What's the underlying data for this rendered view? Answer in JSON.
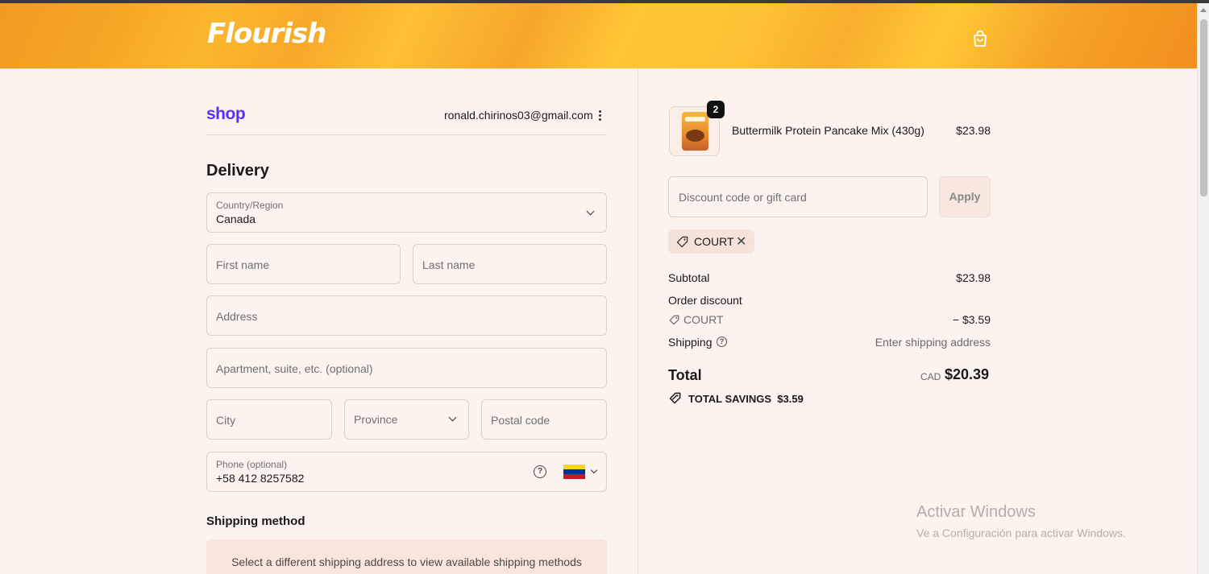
{
  "header": {
    "brand": "Flourish",
    "cart_icon": "shopping-bag-icon"
  },
  "account": {
    "shop_logo": "shop",
    "email": "ronald.chirinos03@gmail.com",
    "menu_icon": "more-vertical-icon"
  },
  "delivery": {
    "title": "Delivery",
    "country_label": "Country/Region",
    "country_value": "Canada",
    "first_name_placeholder": "First name",
    "last_name_placeholder": "Last name",
    "address_placeholder": "Address",
    "apartment_placeholder": "Apartment, suite, etc. (optional)",
    "city_placeholder": "City",
    "province_placeholder": "Province",
    "postal_placeholder": "Postal code",
    "phone_label": "Phone (optional)",
    "phone_value": "+58 412 8257582",
    "flag_colors": [
      "#f9d616",
      "#0033a0",
      "#cf142b"
    ]
  },
  "shipping_method": {
    "title": "Shipping method",
    "message": "Select a different shipping address to view available shipping methods"
  },
  "order": {
    "item_name": "Buttermilk Protein Pancake Mix (430g)",
    "item_price": "$23.98",
    "item_quantity": "2",
    "discount_placeholder": "Discount code or gift card",
    "apply_label": "Apply",
    "applied_code": "COURT",
    "remove_icon": "close-icon",
    "subtotal_label": "Subtotal",
    "subtotal_value": "$23.98",
    "order_discount_label": "Order discount",
    "discount_code": "COURT",
    "discount_value": "− $3.59",
    "shipping_label": "Shipping",
    "shipping_value": "Enter shipping address",
    "total_label": "Total",
    "total_currency": "CAD",
    "total_value": "$20.39",
    "savings_label": "TOTAL SAVINGS",
    "savings_value": "$3.59"
  },
  "watermark": {
    "line1": "Activar Windows",
    "line2": "Ve a Configuración para activar Windows."
  }
}
